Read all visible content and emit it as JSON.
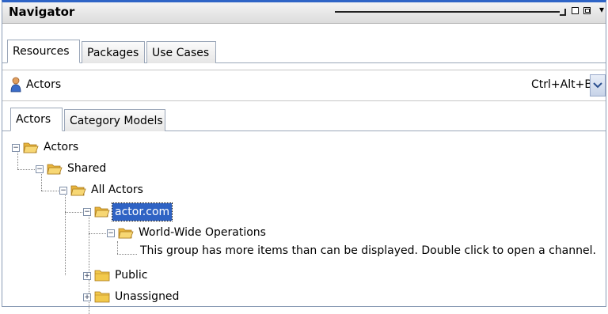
{
  "titlebar": {
    "title": "Navigator",
    "icons": [
      "restore-icon",
      "maximize-icon",
      "more-icon"
    ]
  },
  "main_tabs": [
    {
      "label": "Resources",
      "active": true
    },
    {
      "label": "Packages",
      "active": false
    },
    {
      "label": "Use Cases",
      "active": false
    }
  ],
  "selector": {
    "icon": "person-icon",
    "label": "Actors",
    "shortcut": "Ctrl+Alt+B",
    "dropdown_icon": "chevron-down-icon"
  },
  "inner_tabs": [
    {
      "label": "Actors",
      "active": true
    },
    {
      "label": "Category Models",
      "active": false
    }
  ],
  "tree": {
    "items": [
      {
        "label": "Actors",
        "expanded": true,
        "level": 0
      },
      {
        "label": "Shared",
        "expanded": true,
        "level": 1
      },
      {
        "label": "All Actors",
        "expanded": true,
        "level": 2
      },
      {
        "label": "actor.com",
        "expanded": true,
        "level": 3,
        "selected": true
      },
      {
        "label": "World-Wide Operations",
        "expanded": true,
        "level": 4
      },
      {
        "label": "Public",
        "expanded": false,
        "level": 3
      },
      {
        "label": "Unassigned",
        "expanded": false,
        "level": 3
      }
    ],
    "info_message": "This group has more items than can be displayed. Double click to open a channel."
  },
  "colors": {
    "accent": "#2e64c6",
    "selection": "#2f63c4",
    "folder": "#f2c94c"
  }
}
